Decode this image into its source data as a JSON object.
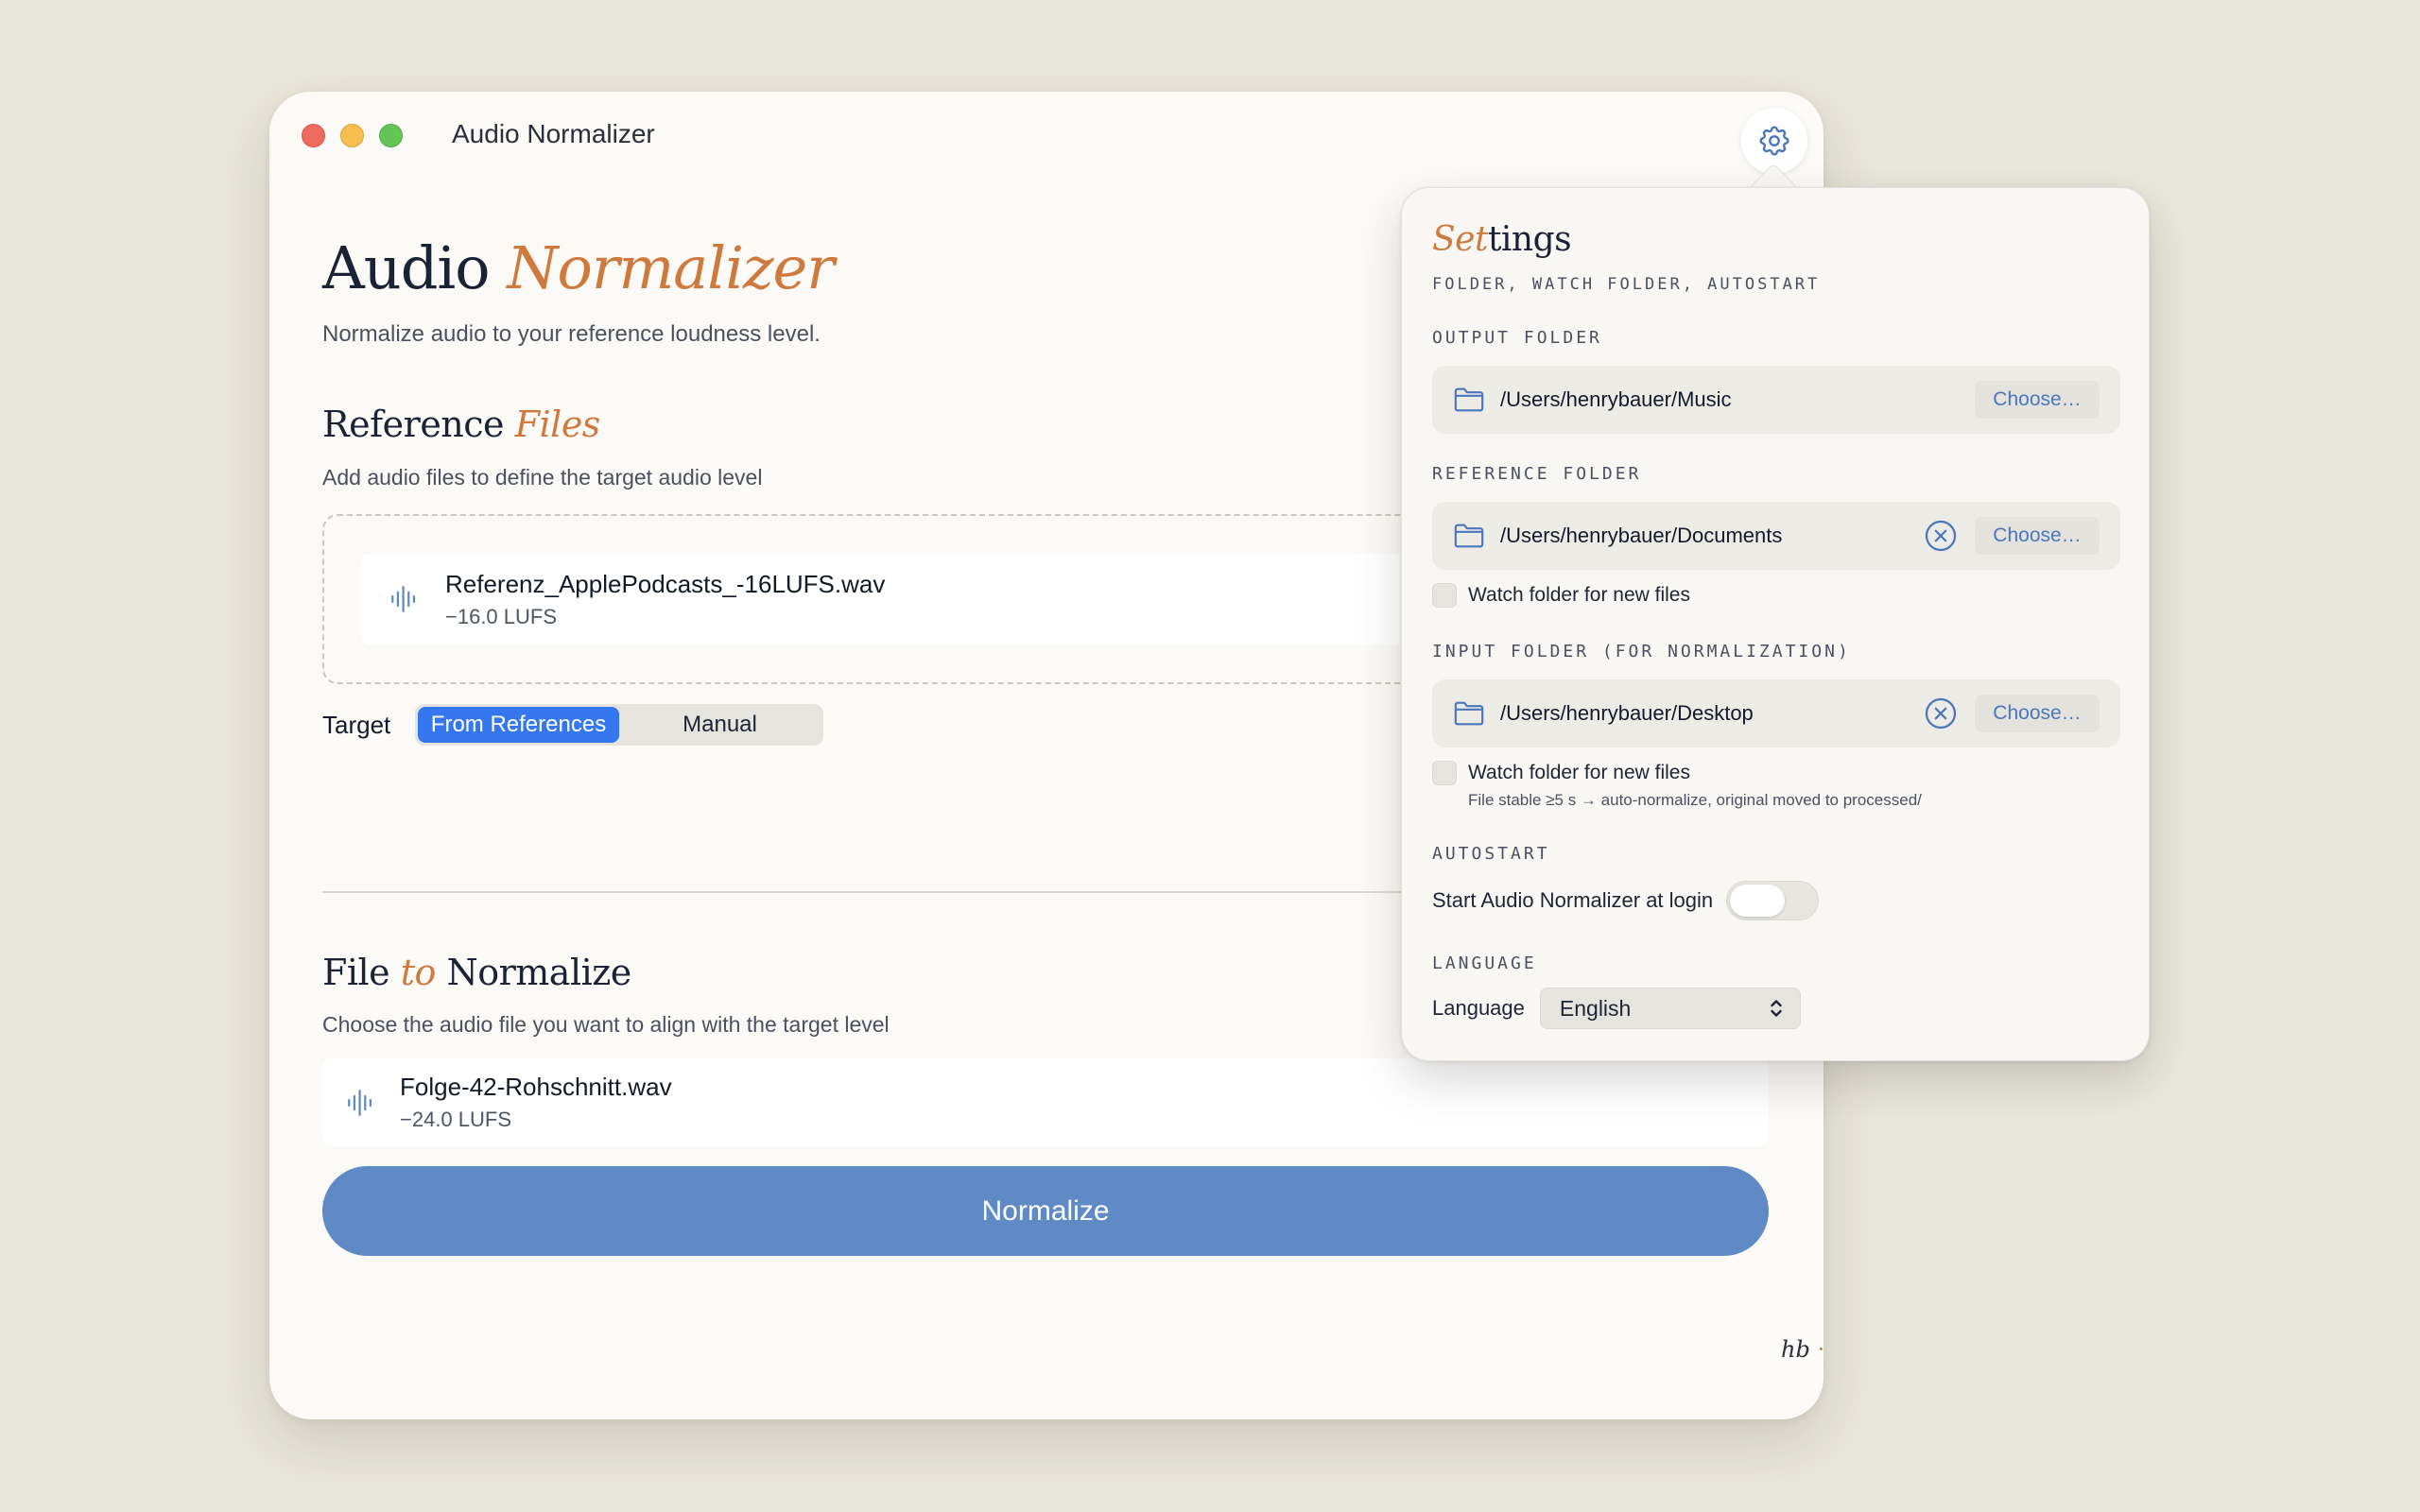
{
  "window": {
    "title": "Audio Normalizer"
  },
  "header": {
    "title_plain": "Audio ",
    "title_accent": "Normalizer",
    "subtitle": "Normalize audio to your reference loudness level."
  },
  "reference": {
    "heading_plain": "Reference ",
    "heading_accent": "Files",
    "description": "Add audio files to define the target audio level",
    "files": [
      {
        "name": "Referenz_ApplePodcasts_-16LUFS.wav",
        "lufs": "−16.0 LUFS"
      }
    ],
    "target_label": "Target",
    "target_options": [
      "From References",
      "Manual"
    ],
    "target_selected": "From References"
  },
  "normalize_section": {
    "heading_a": "File ",
    "heading_accent": "to",
    "heading_b": " Normalize",
    "description": "Choose the audio file you want to align with the target level",
    "file": {
      "name": "Folge-42-Rohschnitt.wav",
      "lufs": "−24.0 LUFS"
    }
  },
  "actions": {
    "normalize_label": "Normalize"
  },
  "footer": {
    "mark": "hb",
    "dot": "·"
  },
  "settings": {
    "title_accent": "Set",
    "title_rest": "tings",
    "subtitle": "FOLDER, WATCH FOLDER, AUTOSTART",
    "output_folder": {
      "label": "OUTPUT FOLDER",
      "path": "/Users/henrybauer/Music",
      "choose_label": "Choose…"
    },
    "reference_folder": {
      "label": "REFERENCE FOLDER",
      "path": "/Users/henrybauer/Documents",
      "choose_label": "Choose…",
      "watch_label": "Watch folder for new files",
      "watch_checked": false
    },
    "input_folder": {
      "label": "INPUT FOLDER (FOR NORMALIZATION)",
      "path": "/Users/henrybauer/Desktop",
      "choose_label": "Choose…",
      "watch_label": "Watch folder for new files",
      "watch_checked": false,
      "hint": "File stable ≥5 s → auto-normalize, original moved to processed/"
    },
    "autostart": {
      "label": "AUTOSTART",
      "toggle_label": "Start Audio Normalizer at login",
      "enabled": false
    },
    "language": {
      "section_label": "LANGUAGE",
      "field_label": "Language",
      "selected": "English"
    }
  },
  "colors": {
    "accent": "#cf7a3c",
    "primary_blue": "#3477ef",
    "button_blue": "#5f8ac5",
    "link_blue": "#4a76bd"
  }
}
